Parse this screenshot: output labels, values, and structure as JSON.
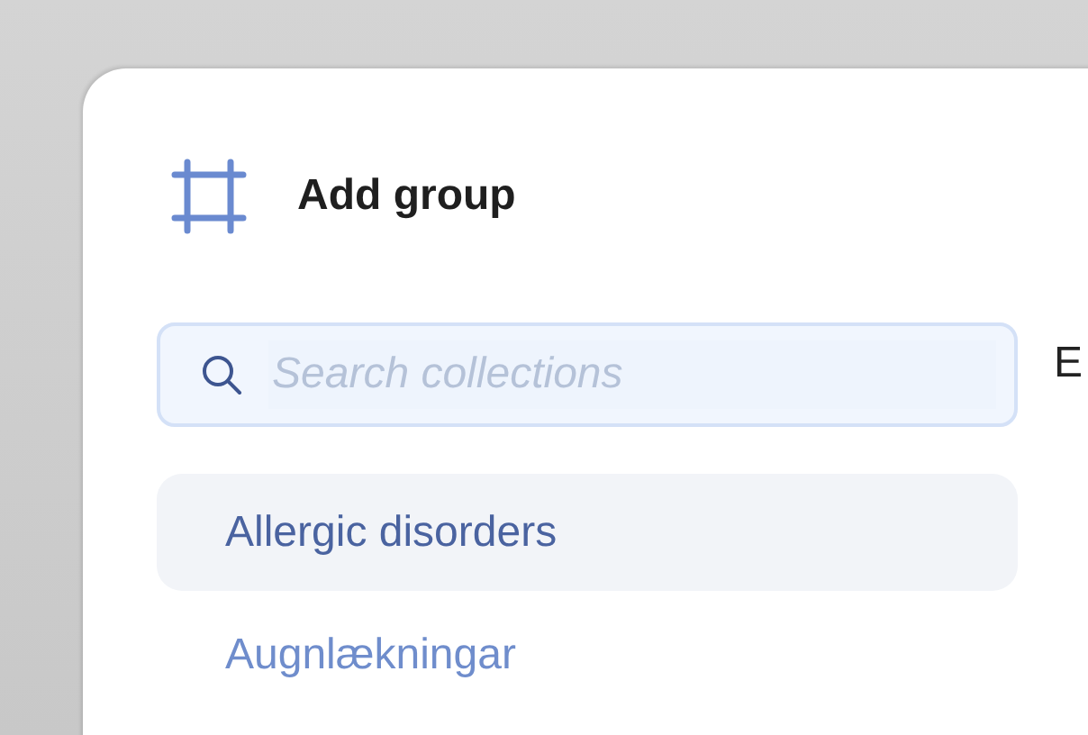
{
  "dialog": {
    "title": "Add group"
  },
  "search": {
    "placeholder": "Search collections"
  },
  "side_text": "E",
  "collections": [
    {
      "label": "Allergic disorders",
      "selected": true
    },
    {
      "label": "Augnlækningar",
      "selected": false
    }
  ]
}
